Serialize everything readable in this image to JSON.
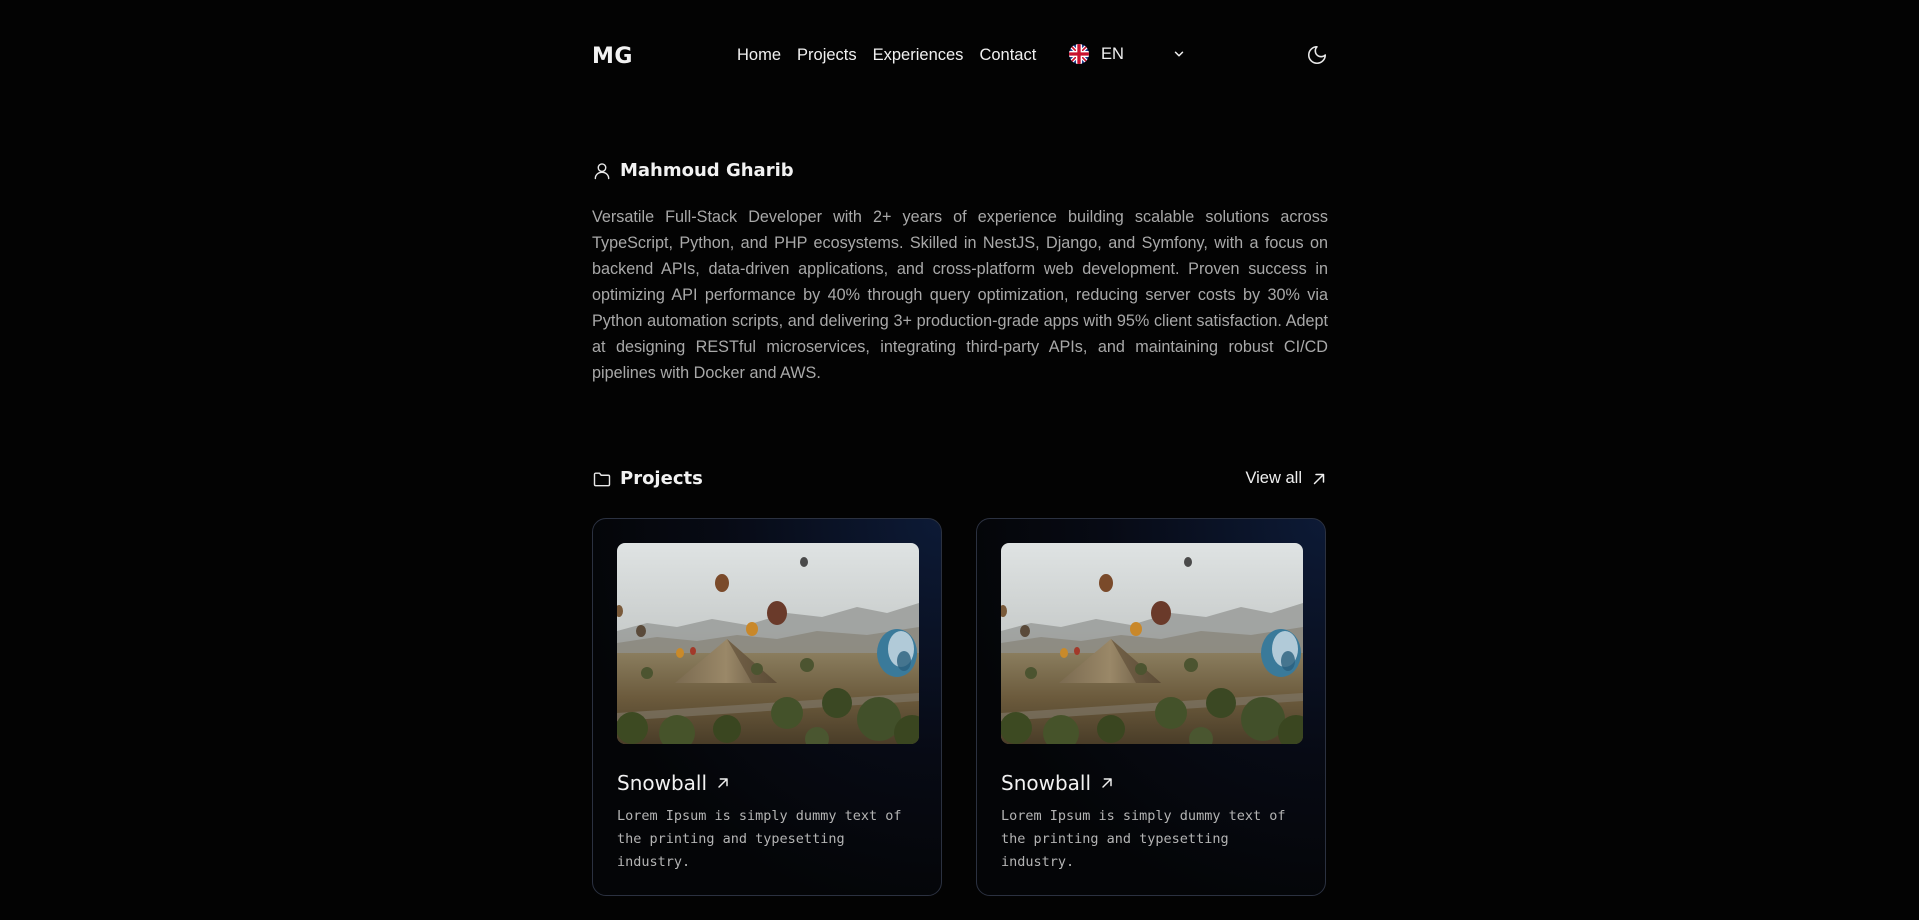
{
  "header": {
    "logo": "MG",
    "nav": [
      {
        "label": "Home"
      },
      {
        "label": "Projects"
      },
      {
        "label": "Experiences"
      },
      {
        "label": "Contact"
      }
    ],
    "language": {
      "selected": "EN",
      "flag_icon": "uk-flag-icon"
    },
    "theme_icon": "moon-icon"
  },
  "about": {
    "name": "Mahmoud Gharib",
    "icon": "user-icon",
    "bio": "Versatile Full-Stack Developer with 2+ years of experience building scalable solutions across TypeScript, Python, and PHP ecosystems. Skilled in NestJS, Django, and Symfony, with a focus on backend APIs, data-driven applications, and cross-platform web development. Proven success in optimizing API performance by 40% through query optimization, reducing server costs by 30% via Python automation scripts, and delivering 3+ production-grade apps with 95% client satisfaction. Adept at designing RESTful microservices, integrating third-party APIs, and maintaining robust CI/CD pipelines with Docker and AWS."
  },
  "projects": {
    "title": "Projects",
    "icon": "folder-icon",
    "view_all_label": "View all",
    "items": [
      {
        "title": "Snowball",
        "description": "Lorem Ipsum is simply dummy text of the printing and typesetting industry."
      },
      {
        "title": "Snowball",
        "description": "Lorem Ipsum is simply dummy text of the printing and typesetting industry."
      }
    ]
  },
  "colors": {
    "background": "#030303",
    "text": "#f0f0f0",
    "muted_text": "#a9a9a9",
    "card_border": "#2b3140",
    "card_glow": "#0d1a36"
  }
}
